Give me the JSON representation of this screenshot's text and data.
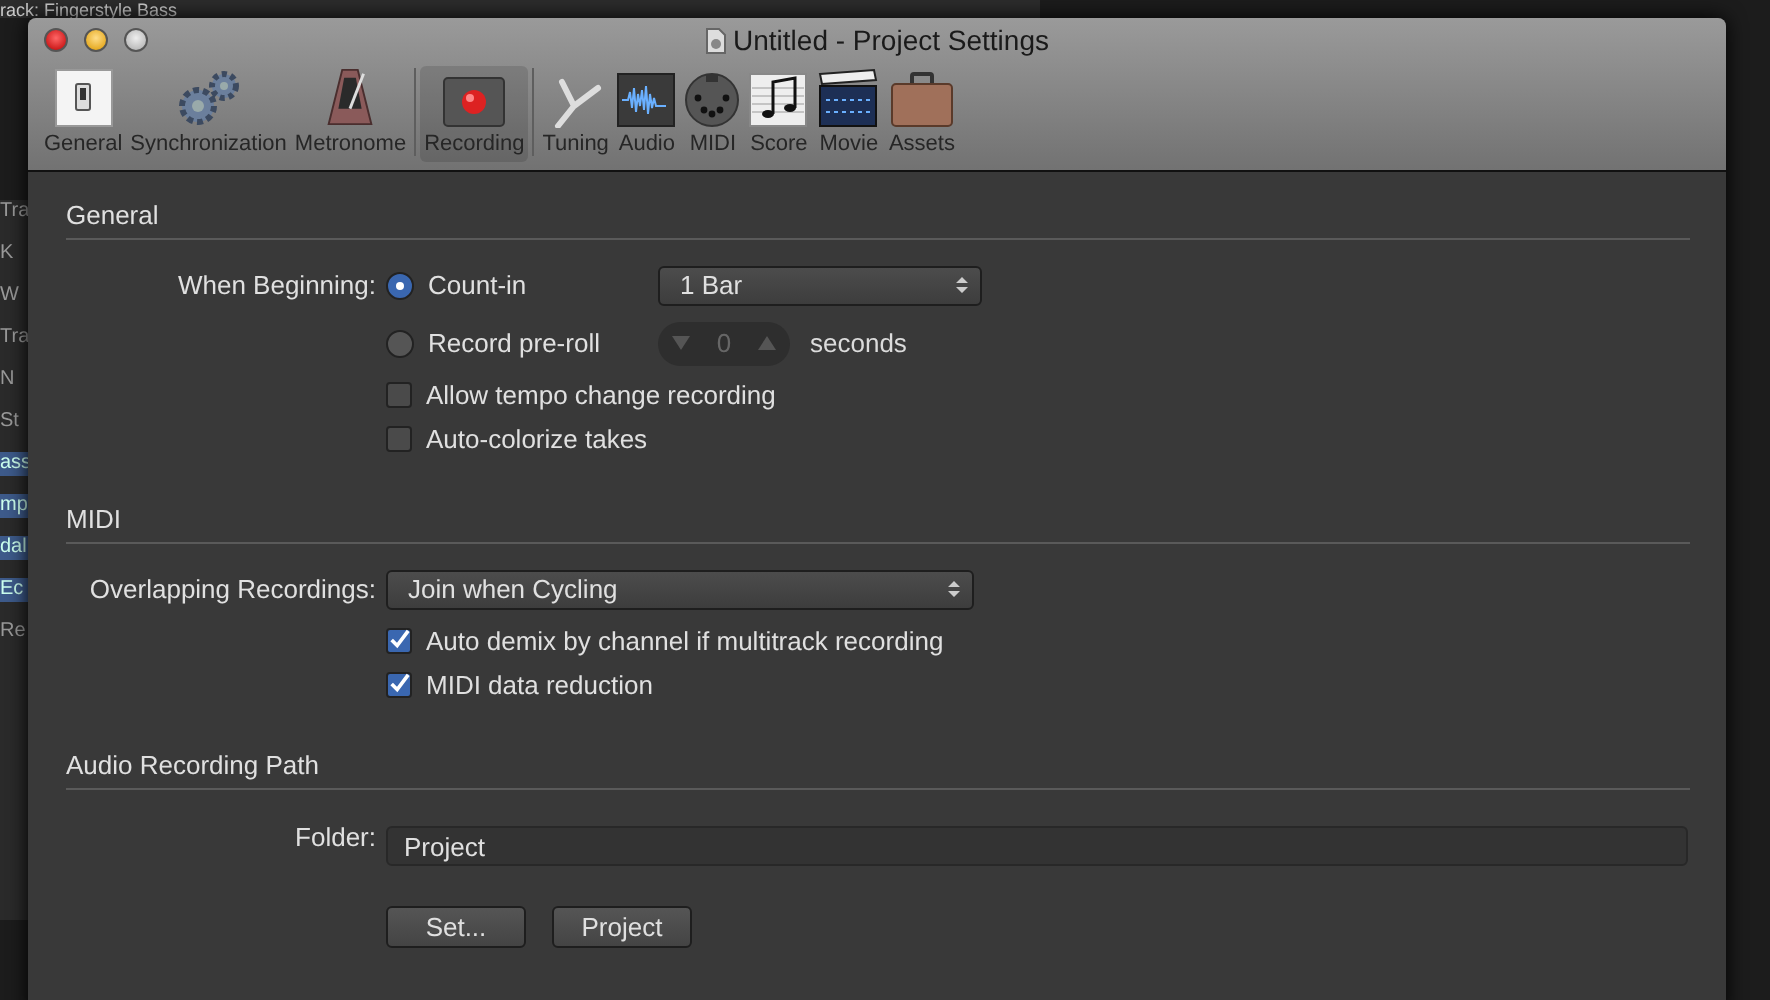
{
  "background_app": {
    "track_label": "rack:  Fingerstyle Bass",
    "strip_texts": [
      "Tra",
      "K",
      "W",
      "Tra",
      "N",
      "St",
      "ass",
      "mp",
      "dal",
      "Ec",
      "Re"
    ]
  },
  "window": {
    "title": "Untitled - Project Settings"
  },
  "toolbar": [
    {
      "label": "General",
      "selected": false
    },
    {
      "label": "Synchronization",
      "selected": false
    },
    {
      "label": "Metronome",
      "selected": false
    },
    {
      "label": "Recording",
      "selected": true
    },
    {
      "label": "Tuning",
      "selected": false
    },
    {
      "label": "Audio",
      "selected": false
    },
    {
      "label": "MIDI",
      "selected": false
    },
    {
      "label": "Score",
      "selected": false
    },
    {
      "label": "Movie",
      "selected": false
    },
    {
      "label": "Assets",
      "selected": false
    }
  ],
  "general": {
    "heading": "General",
    "when_beginning_label": "When Beginning:",
    "options": [
      {
        "label": "Count-in",
        "selected": true
      },
      {
        "label": "Record pre-roll",
        "selected": false
      }
    ],
    "count_in_popup": "1 Bar",
    "preroll_stepper": {
      "value": "0",
      "disabled": true,
      "unit": "seconds"
    },
    "checkboxes": [
      {
        "label": "Allow tempo change recording",
        "checked": false
      },
      {
        "label": "Auto-colorize takes",
        "checked": false
      }
    ]
  },
  "midi": {
    "heading": "MIDI",
    "overlapping_label": "Overlapping Recordings:",
    "overlapping_popup": "Join when Cycling",
    "checkboxes": [
      {
        "label": "Auto demix by channel if multitrack recording",
        "checked": true
      },
      {
        "label": "MIDI data reduction",
        "checked": true
      }
    ]
  },
  "audio_path": {
    "heading": "Audio Recording Path",
    "folder_label": "Folder:",
    "folder_value": "Project",
    "buttons": [
      "Set...",
      "Project"
    ]
  }
}
